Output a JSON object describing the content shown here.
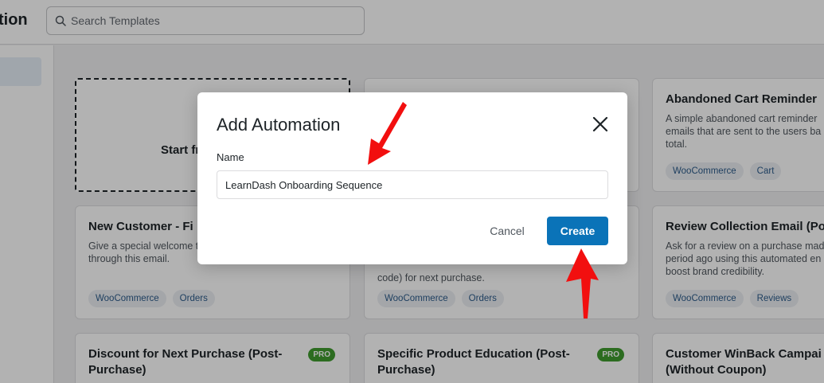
{
  "header": {
    "title": "tion",
    "search": {
      "placeholder": "Search Templates",
      "value": ""
    }
  },
  "start_card": {
    "label": "Start fr"
  },
  "cards": [
    {
      "title": "",
      "desc": "",
      "tags": []
    },
    {
      "title": "Abandoned Cart Reminder",
      "desc": "A simple abandoned cart reminder emails that are sent to the users ba total.",
      "tags": [
        "WooCommerce",
        "Cart"
      ]
    },
    {
      "title": "New Customer - Fi",
      "desc": "Give a special welcome t through this email.",
      "tags": [
        "WooCommerce",
        "Orders"
      ]
    },
    {
      "title": "",
      "desc": "code) for next purchase.",
      "tags": [
        "WooCommerce",
        "Orders"
      ]
    },
    {
      "title": "Review Collection Email (Po",
      "desc": "Ask for a review on a purchase mad period ago using this automated en boost brand credibility.",
      "tags": [
        "WooCommerce",
        "Reviews"
      ]
    },
    {
      "title": "Discount for Next Purchase (Post-Purchase)",
      "desc": "",
      "tags": [],
      "badge": "PRO"
    },
    {
      "title": "Specific Product Education (Post-Purchase)",
      "desc": "",
      "tags": [],
      "badge": "PRO"
    },
    {
      "title": "Customer WinBack Campai (Without Coupon)",
      "desc": "",
      "tags": []
    }
  ],
  "modal": {
    "title": "Add Automation",
    "name_label": "Name",
    "name_value": "LearnDash Onboarding Sequence",
    "cancel_label": "Cancel",
    "create_label": "Create"
  },
  "colors": {
    "primary": "#0a73b8",
    "arrow": "#f20f0f",
    "pro_badge": "#3f9b2f",
    "tag_text": "#2c5b8a"
  },
  "icons": [
    "search-icon",
    "close-icon",
    "arrow-annotation-icon"
  ]
}
